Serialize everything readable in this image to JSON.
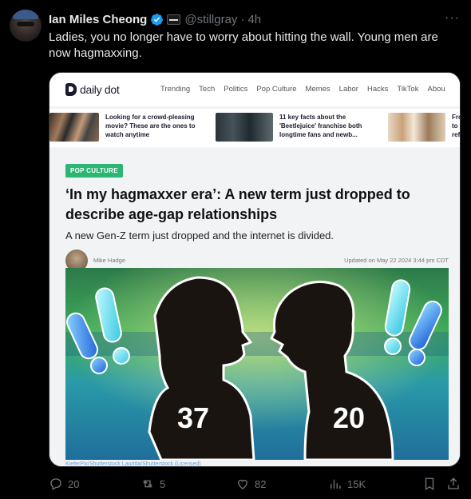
{
  "tweet": {
    "author_name": "Ian Miles Cheong",
    "handle": "@stillgray",
    "separator": "·",
    "time": "4h",
    "text": "Ladies, you no longer have to worry about hitting the wall. Young men are now hagmaxxing."
  },
  "card": {
    "site_name": "daily dot",
    "nav_links": [
      "Trending",
      "Tech",
      "Politics",
      "Pop Culture",
      "Memes",
      "Labor",
      "Hacks",
      "TikTok",
      "Abou"
    ],
    "related": [
      {
        "text": "Looking for a crowd-pleasing movie? These are the ones to watch anytime"
      },
      {
        "text": "11 key facts about the 'Beetlejuice' franchise both longtime fans and newb..."
      },
      {
        "text": "Fro to f ref"
      }
    ],
    "tag": "POP CULTURE",
    "headline": "‘In my hagmaxxer era’: A new term just dropped to describe age-gap relationships",
    "dek": "A new Gen-Z term just dropped and the internet is divided.",
    "author": "Mike Hadge",
    "updated": "Updated on May 22 2024 3:44 pm CDT",
    "image_numbers": {
      "left": "37",
      "right": "20"
    },
    "credit": "KieferPix/Shutterstock Lauritta/Shutterstock (Licensed)"
  },
  "actions": {
    "replies": "20",
    "reposts": "5",
    "likes": "82",
    "views": "15K"
  },
  "colors": {
    "background": "#000000",
    "text": "#e7e9ea",
    "muted": "#71767b",
    "verified": "#1d9bf0",
    "tag_green": "#2bb673"
  },
  "icons": [
    "verified-badge-icon",
    "affiliate-badge-icon",
    "more-icon",
    "reply-icon",
    "repost-icon",
    "like-icon",
    "views-icon",
    "bookmark-icon",
    "share-icon"
  ]
}
